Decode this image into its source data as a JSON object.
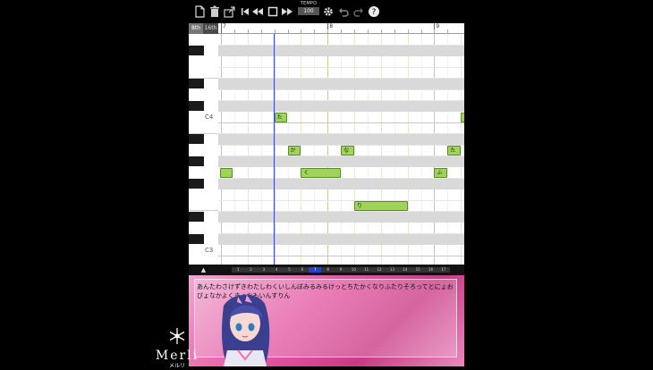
{
  "toolbar": {
    "icons": [
      "new-file-icon",
      "trash-icon",
      "export-icon",
      "skip-to-start-icon",
      "rewind-icon",
      "stop-icon",
      "fast-forward-icon",
      "settings-gear-icon",
      "undo-icon",
      "redo-icon",
      "help-icon"
    ],
    "tempo_label": "TEMPO",
    "tempo_value": "100"
  },
  "editor": {
    "resolution_8th": "8th",
    "resolution_16th": "16th",
    "measures": [
      "7",
      "8",
      "9"
    ],
    "octave_labels": [
      "C4",
      "C3"
    ],
    "notes": [
      {
        "lyric": "た",
        "pitch": "C4"
      },
      {
        "lyric": "か",
        "pitch": "A3"
      },
      {
        "lyric": "く",
        "pitch": "G3"
      },
      {
        "lyric": "な",
        "pitch": "A3"
      },
      {
        "lyric": "り",
        "pitch": "E3"
      },
      {
        "lyric": "ふ",
        "pitch": "G3"
      },
      {
        "lyric": "た",
        "pitch": "A3"
      },
      {
        "lyric": "り",
        "pitch": "C4"
      },
      {
        "lyric": "",
        "pitch": "G3"
      }
    ]
  },
  "bottombar": {
    "scroll_up": "▲",
    "beats": [
      "1",
      "2",
      "3",
      "4",
      "5",
      "6",
      "7",
      "8",
      "9",
      "10",
      "11",
      "12",
      "13",
      "14",
      "15",
      "16",
      "17"
    ],
    "active_beat": 7
  },
  "lyrics": {
    "text": "あんたわさけずきわたしわくいしんぼみるみるけっとちたかくなりふたりそろってとにょおぴょなかよくきょおもいんすりん"
  },
  "branding": {
    "name": "Merli",
    "sub": "メルリ"
  },
  "colors": {
    "note_fill": "#9fd35a",
    "playhead": "#3344ee",
    "panel_pink": "#e55aa5"
  }
}
